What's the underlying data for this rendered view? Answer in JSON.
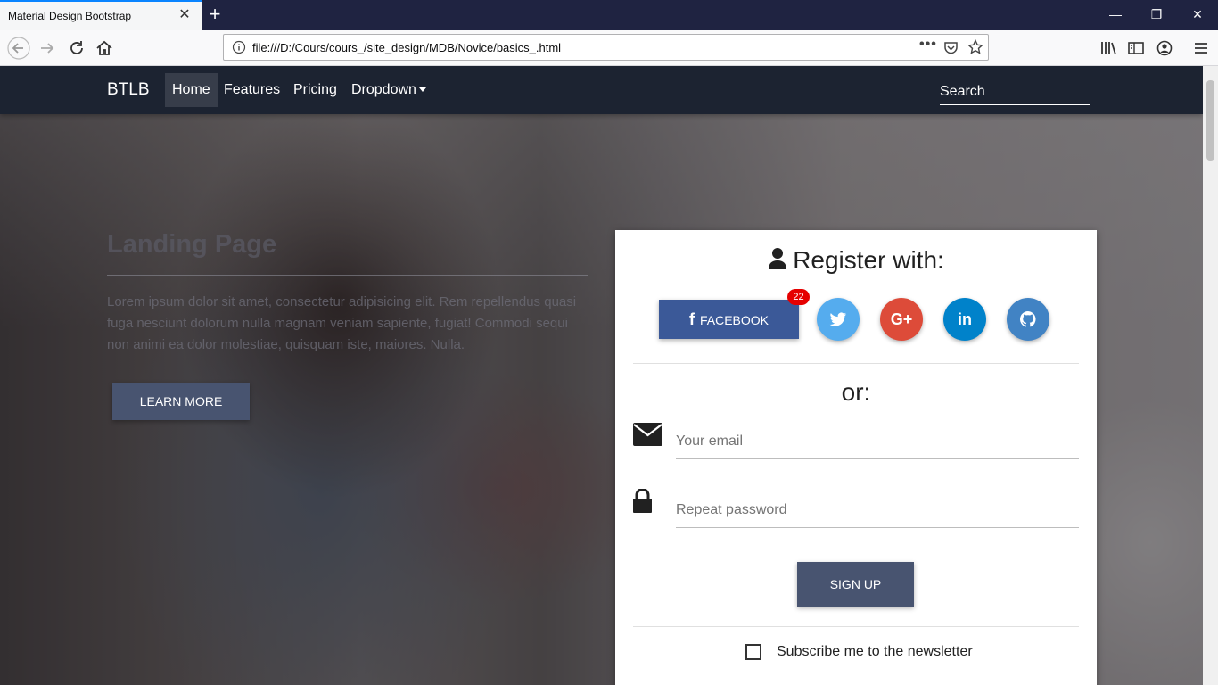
{
  "browser": {
    "tab_title": "Material Design Bootstrap",
    "url": "file:///D:/Cours/cours_/site_design/MDB/Novice/basics_.html"
  },
  "nav": {
    "brand": "BTLB",
    "items": [
      "Home",
      "Features",
      "Pricing",
      "Dropdown"
    ],
    "search_placeholder": "Search"
  },
  "hero": {
    "title": "Landing Page",
    "text": "Lorem ipsum dolor sit amet, consectetur adipisicing elit. Rem repellendus quasi fuga nesciunt dolorum nulla magnam veniam sapiente, fugiat! Commodi sequi non animi ea dolor molestiae, quisquam iste, maiores. Nulla.",
    "button": "LEARN MORE"
  },
  "register": {
    "title": "Register with:",
    "facebook_label": "FACEBOOK",
    "facebook_badge": "22",
    "social_icons": [
      "twitter-icon",
      "google-plus-icon",
      "linkedin-icon",
      "github-icon"
    ],
    "social_colors": {
      "facebook": "#3b5998",
      "twitter": "#55acee",
      "google": "#dd4b39",
      "linkedin": "#0082ca",
      "github": "#4183c4"
    },
    "or": "or:",
    "email_placeholder": "Your email",
    "password_placeholder": "Repeat password",
    "signup_button": "SIGN UP",
    "newsletter_label": "Subscribe me to the newsletter"
  }
}
